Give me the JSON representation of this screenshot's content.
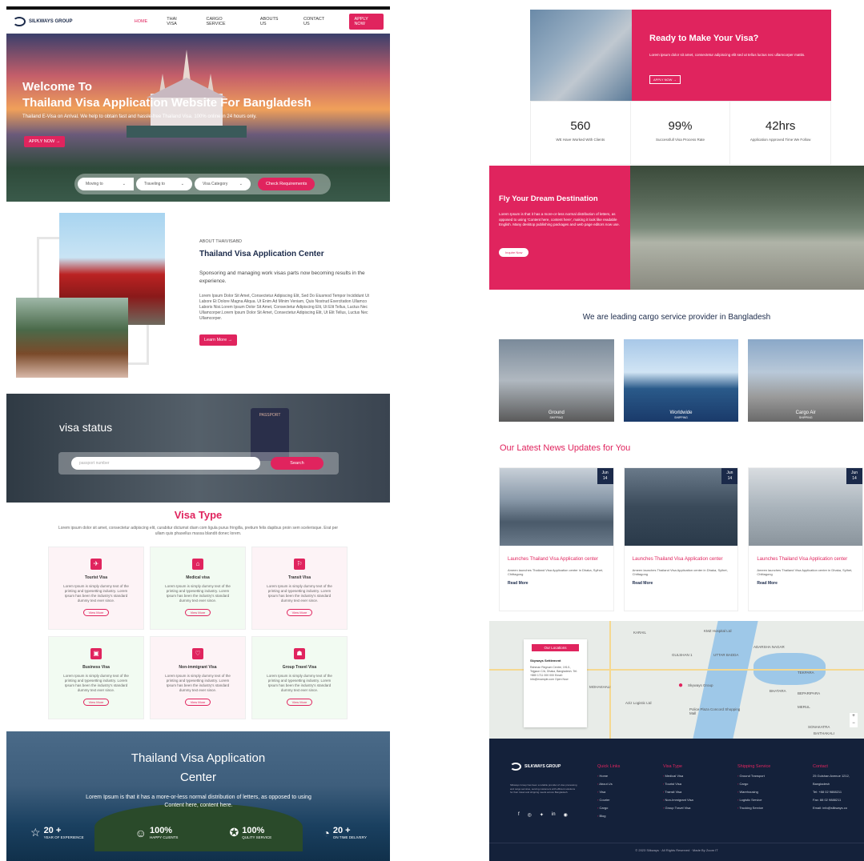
{
  "nav": {
    "logo": "SILKWAYS GROUP",
    "items": [
      "HOME",
      "THAI VISA",
      "CARGO SERVICE",
      "ABOUTS US",
      "CONTACT US"
    ],
    "apply": "APPLY NOW"
  },
  "hero": {
    "title_line1": "Welcome To",
    "title_line2": "Thailand Visa Application Website  For Bangladesh",
    "subtitle": "Thailand E-Visa on Arrival. We help to obtain fast and hassle-free Thailand Visa. 100% online in 24 hours only.",
    "apply": "APPLY NOW  →",
    "selects": [
      "Moving to",
      "Traveling to",
      "Visa Category"
    ],
    "check": "Check Requirements"
  },
  "about": {
    "tag": "ABOUT THAIVISABD",
    "title": "Thailand Visa Application Center",
    "lead": "Sponsoring and managing work visas parts now becoming results in the experience.",
    "body": "Lorem Ipsum Dolor Sit Amet, Consectetur Adipiscing Elit, Sed Do Eiusmod Tempor Incididunt Ut Labore Et Dolore Magna Aliqua. Ut Enim Ad Minim Veniam, Quis Nostrud Exercitation Ullamco Laboris Nisi.Lorem Ipsum Dolor Sit Amet, Consectetur Adipiscing Elit, Ut Elit Tellus, Luctus Nec Ullamcorper.Lorem Ipsum Dolor Sit Amet, Consectetur Adipiscing Elit, Ut Elit Tellus, Luctus Nec Ullamcorper.",
    "learn": "Learn More  →"
  },
  "visa_status": {
    "title": "visa status",
    "passport": "PASSPORT",
    "placeholder": "passport number",
    "search": "Search"
  },
  "visa_type": {
    "title": "Visa Type",
    "desc": "Lorem ipsum dolor sit amet, consectetur adipiscing elit, curabitur dictumst diam com ligula purus fringilla, pretium felis dapibus proin sem scelerisque. Erat per ullam quis phasellus massa blandit donec lorem.",
    "card_desc": "Lorem Ipsum is simply dummy text of the printing and typesetting industry. Lorem Ipsum has been the industry's standard dummy text ever since.",
    "view_more": "View More",
    "cards": [
      {
        "title": "Tourist Visa",
        "icon": "✈"
      },
      {
        "title": "Medical visa",
        "icon": "⌂"
      },
      {
        "title": "Transit Visa",
        "icon": "⚐"
      },
      {
        "title": "Business Visa",
        "icon": "▣"
      },
      {
        "title": "Non-immigrant Visa",
        "icon": "♡"
      },
      {
        "title": "Group Travel Visa",
        "icon": "☗"
      }
    ]
  },
  "center": {
    "title_line1": "Thailand Visa Application",
    "title_line2": "Center",
    "text": "Lorem Ipsum is that it has a more-or-less normal distribution of letters, as opposed to using Content here, content here.",
    "stats": [
      {
        "icon": "☆",
        "num": "20 +",
        "label": "YEAR OF EXPERIENCE"
      },
      {
        "icon": "☺",
        "num": "100%",
        "label": "HAPPY CLIENTS"
      },
      {
        "icon": "✪",
        "num": "100%",
        "label": "QULITY SERVICE"
      },
      {
        "icon": "◔",
        "num": "20 +",
        "label": "ON TIME DELIVERY"
      }
    ]
  },
  "ready": {
    "title": "Ready to Make Your Visa?",
    "text": "Lorem ipsum dolor sit amet, consectetur adipiscing elit sed ut tellus luctus nec ullamcorper mattis.",
    "button": "APPLY NOW  →",
    "stats": [
      {
        "num": "560",
        "label": "WE Have Worked With Clients"
      },
      {
        "num": "99%",
        "label": "Successfull Visa Process Rate"
      },
      {
        "num": "42hrs",
        "label": "Application Approved Time We Follow"
      }
    ]
  },
  "fly": {
    "title": "Fly Your Dream Destination",
    "text": "Lorem Ipsum is that it has a more-or-less normal distribution of letters, as opposed to using 'Content here, content here', making it look like readable English. Many desktop publishing packages and web page editors now use.",
    "button": "Inquire Now"
  },
  "cargo": {
    "heading": "We are leading cargo service provider in Bangladesh",
    "items": [
      {
        "name": "Ground",
        "sub": "SHIPPING"
      },
      {
        "name": "Worldwide",
        "sub": "SHIPPING"
      },
      {
        "name": "Cargo Air",
        "sub": "SHIPPING"
      }
    ]
  },
  "news": {
    "heading": "Our Latest News Updates for You",
    "read_more": "Read More",
    "items": [
      {
        "day": "Jun",
        "date": "14",
        "title": "Launches Thailand Visa Application center",
        "desc": "Ameen launches Thailand Visa Application center in Dhaka, Sylhet, Chittagong"
      },
      {
        "day": "Jun",
        "date": "14",
        "title": "Launches Thailand Visa Application center",
        "desc": "Ameen launches Thailand Visa Application center in Dhaka, Sylhet, Chittagong"
      },
      {
        "day": "Jun",
        "date": "14",
        "title": "Launches Thailand Visa Application center",
        "desc": "Ameen launches Thailand Visa Application center in Dhaka, Sylhet, Chittagong"
      }
    ]
  },
  "map": {
    "card_title": "Our Locations",
    "company": "Skyways Settlement",
    "address": "Rahman Regnum Centre, 191/1, Tejgaon C/A, Dhaka, Bangladesh. Tel: +880 1711 000 000 Email: info@example.com Open Now",
    "labels": [
      "KARAIL",
      "GULSHAN 1",
      "UTTAR BADDA",
      "ADARSHA NAGAR",
      "TEKPARA",
      "BHATARA",
      "MOHAKHALI",
      "BEPARIPARA",
      "SONAKATRA",
      "MERUL",
      "BAITHAKALI",
      "Skyways Group",
      "KMZ Hospital Ltd",
      "Aziz Logistic Ltd",
      "Police Plaza Concord Shopping Mall"
    ],
    "zoom_in": "+",
    "zoom_out": "−"
  },
  "footer": {
    "logo": "SILKWAYS GROUP",
    "desc": "Silkways Group has been a reliable provider of visa processing and cargo services, serving customers with efficient solutions for their travel and shipping needs across Bangladesh.",
    "social": [
      "f",
      "◎",
      "✦",
      "in",
      "◉"
    ],
    "cols": [
      {
        "title": "Quick Links",
        "items": [
          "Home",
          "About Us",
          "Visa",
          "Courier",
          "Cargo",
          "Blog"
        ]
      },
      {
        "title": "Visa Type",
        "items": [
          "Medical Visa",
          "Tourist Visa",
          "Transit Visa",
          "Non-Immigrant Visa",
          "Group Travel Visa"
        ]
      },
      {
        "title": "Shipping Service",
        "items": [
          "Ground Transport",
          "Cargo",
          "Warehousing",
          "Logistic Service",
          "Trucking Service"
        ]
      },
      {
        "title": "Contact",
        "items": [
          "25 Gulshan Avenue 1212,",
          "Bangladesh",
          "Tel: +88 02 9888211",
          "Fax: 88 02 9888211",
          "Email: info@silkways.co"
        ]
      }
    ],
    "copyright": "© 2023 Silkways · All Rights Reserved · Made By Zoom IT"
  }
}
